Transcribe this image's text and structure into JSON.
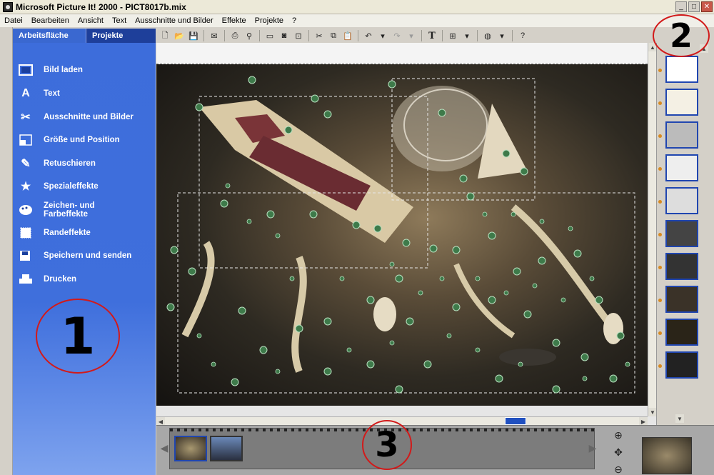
{
  "window": {
    "title": "Microsoft Picture It! 2000 - PICT8017b.mix",
    "minimize_icon": "minimize-icon",
    "maximize_icon": "maximize-icon",
    "close_icon": "close-icon"
  },
  "menu": {
    "items": [
      "Datei",
      "Bearbeiten",
      "Ansicht",
      "Text",
      "Ausschnitte und Bilder",
      "Effekte",
      "Projekte",
      "?"
    ]
  },
  "tabs": {
    "workspace": "Arbeitsfläche",
    "projects": "Projekte"
  },
  "toolbar": {
    "text_button_label": "T"
  },
  "sidebar": {
    "items": [
      {
        "label": "Bild laden",
        "icon": "picture-frame-icon"
      },
      {
        "label": "Text",
        "icon": "letter-a-icon"
      },
      {
        "label": "Ausschnitte und Bilder",
        "icon": "scissors-icon"
      },
      {
        "label": "Größe und Position",
        "icon": "resize-icon"
      },
      {
        "label": "Retuschieren",
        "icon": "retouch-brush-icon"
      },
      {
        "label": "Spezialeffekte",
        "icon": "star-icon"
      },
      {
        "label": "Zeichen- und",
        "label2": "Farbeffekte",
        "icon": "palette-icon"
      },
      {
        "label": "Randeffekte",
        "icon": "border-icon"
      },
      {
        "label": "Speichern und senden",
        "icon": "save-send-icon"
      },
      {
        "label": "Drucken",
        "icon": "printer-icon"
      }
    ]
  },
  "annotations": {
    "a1": "1",
    "a2": "2",
    "a3": "3"
  },
  "accent_colors": {
    "sidebar_blue": "#3d6ddb",
    "tab_dark": "#1e3f9a",
    "annotation_red": "#d21a1a",
    "thumb_border": "#2046b0",
    "handle_green": "#3e7a4a"
  }
}
